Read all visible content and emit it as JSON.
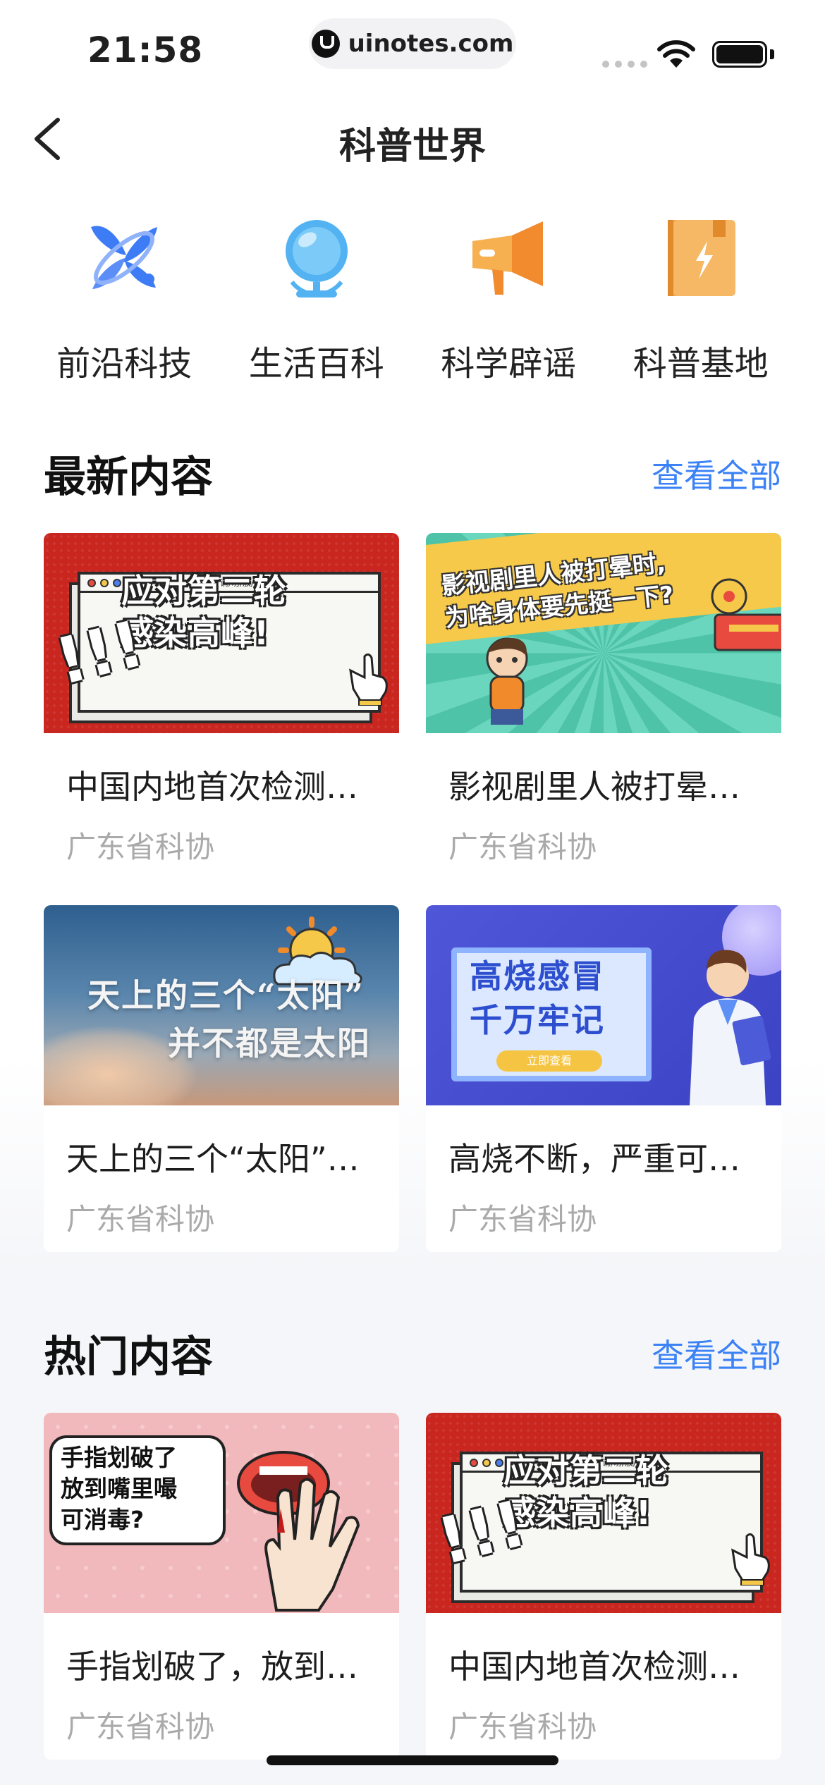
{
  "status_bar": {
    "time": "21:58",
    "url": "uinotes.com"
  },
  "nav": {
    "title": "科普世界",
    "back_icon": "chevron-left-icon"
  },
  "categories": [
    {
      "label": "前沿科技",
      "icon": "satellite-icon",
      "color": "#3d7cf5"
    },
    {
      "label": "生活百科",
      "icon": "globe-icon",
      "color": "#4aa8f0"
    },
    {
      "label": "科学辟谣",
      "icon": "megaphone-icon",
      "color": "#f29a3a"
    },
    {
      "label": "科普基地",
      "icon": "book-bolt-icon",
      "color": "#f2a44a"
    }
  ],
  "latest": {
    "title": "最新内容",
    "more": "查看全部",
    "cards": [
      {
        "title": "中国内地首次检测…",
        "source": "广东省科协",
        "thumb": {
          "bar": "疫/情/仍/在  请/勿/放/松",
          "line1": "应对第二轮",
          "line2": "感染高峰!"
        }
      },
      {
        "title": "影视剧里人被打晕…",
        "source": "广东省科协",
        "thumb": {
          "line1": "影视剧里人被打晕时,",
          "line2": "为啥身体要先挺一下?"
        }
      },
      {
        "title": "天上的三个“太阳”…",
        "source": "广东省科协",
        "thumb": {
          "line1": "天上的三个“太阳”",
          "line2": "并不都是太阳"
        }
      },
      {
        "title": "高烧不断，严重可…",
        "source": "广东省科协",
        "thumb": {
          "line1": "高烧感冒",
          "line2": "千万牢记",
          "button": "立即查看"
        }
      }
    ]
  },
  "hot": {
    "title": "热门内容",
    "more": "查看全部",
    "cards": [
      {
        "title": "手指划破了，放到…",
        "source": "广东省科协",
        "thumb": {
          "line1": "手指划破了",
          "line2": "放到嘴里嘬",
          "line3": "可消毒?"
        }
      },
      {
        "title": "中国内地首次检测…",
        "source": "广东省科协",
        "thumb": {
          "bar": "疫/情/仍/在  请/勿/放/松",
          "line1": "应对第二轮",
          "line2": "感染高峰!"
        }
      }
    ]
  },
  "colors": {
    "accent": "#3b82f6",
    "source_gray": "#aaaaaa",
    "background": "#f5f6f9"
  }
}
